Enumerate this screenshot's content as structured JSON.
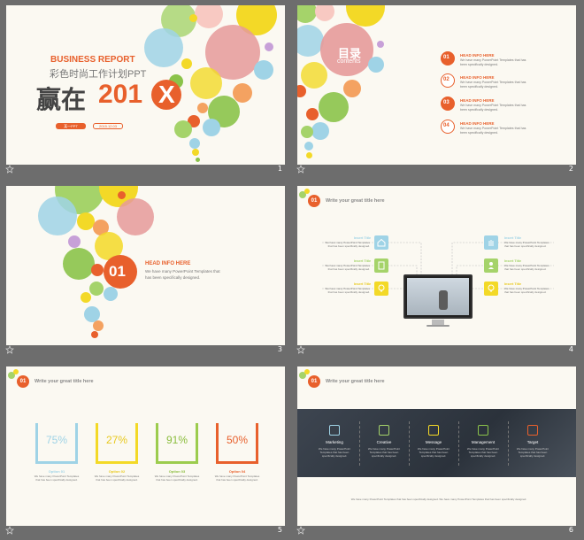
{
  "slides": [
    {
      "number": "1",
      "business_report": "BUSINESS REPORT",
      "subtitle_cn": "彩色时尚工作计划PPT",
      "title_cn": "赢在",
      "year": "201",
      "year_x": "X",
      "tag_left": "某一PPT",
      "tag_right": "2015.12.03"
    },
    {
      "number": "2",
      "toc_title": "目录",
      "toc_sub": "contents",
      "items": [
        {
          "num": "01",
          "head": "HEAD INFO HERE",
          "desc": "We have many PowerPoint Templates that has been specifically designed."
        },
        {
          "num": "02",
          "head": "HEAD INFO HERE",
          "desc": "We have many PowerPoint Templates that has been specifically designed."
        },
        {
          "num": "03",
          "head": "HEAD INFO HERE",
          "desc": "We have many PowerPoint Templates that has been specifically designed."
        },
        {
          "num": "04",
          "head": "HEAD INFO HERE",
          "desc": "We have many PowerPoint Templates that has been specifically designed."
        }
      ]
    },
    {
      "number": "3",
      "badge": "01",
      "head": "HEAD INFO HERE",
      "desc1": "We have many PowerPoint Templates that",
      "desc2": "has been specifically designed."
    },
    {
      "number": "4",
      "badge": "01",
      "title": "Write your great title here",
      "left": [
        {
          "label": "Insert Title",
          "desc": "We have many PowerPoint Templates that has been specifically designed."
        },
        {
          "label": "Insert Title",
          "desc": "We have many PowerPoint Templates that has been specifically designed."
        },
        {
          "label": "Insert Title",
          "desc": "We have many PowerPoint Templates that has been specifically designed."
        }
      ],
      "right": [
        {
          "label": "Insert Title",
          "desc": "We have many PowerPoint Templates that has been specifically designed."
        },
        {
          "label": "Insert Title",
          "desc": "We have many PowerPoint Templates that has been specifically designed."
        },
        {
          "label": "Insert Title",
          "desc": "We have many PowerPoint Templates that has been specifically designed."
        }
      ]
    },
    {
      "number": "5",
      "badge": "01",
      "title": "Write your great title here",
      "options": [
        {
          "percent": "75%",
          "fraction": 0.75,
          "name": "Option 01",
          "color": "#9fd3e6",
          "text": "#9fd3e6",
          "desc": "We have many PowerPoint Templates that has been specifically designed."
        },
        {
          "percent": "27%",
          "fraction": 0.27,
          "name": "Option 02",
          "color": "#f3d927",
          "text": "#e8c91f",
          "desc": "We have many PowerPoint Templates that has been specifically designed."
        },
        {
          "percent": "91%",
          "fraction": 0.91,
          "name": "Option 03",
          "color": "#9ccc4e",
          "text": "#8bbd3e",
          "desc": "We have many PowerPoint Templates that has been specifically designed."
        },
        {
          "percent": "50%",
          "fraction": 0.5,
          "name": "Option 04",
          "color": "#e8602c",
          "text": "#e8602c",
          "desc": "We have many PowerPoint Templates that has been specifically designed."
        }
      ]
    },
    {
      "number": "6",
      "badge": "01",
      "title": "Write your great title here",
      "cols": [
        {
          "name": "Marketing",
          "icon": "rocket-icon",
          "desc": "We have many PowerPoint Templates that has been specifically designed."
        },
        {
          "name": "Creative",
          "icon": "camera-icon",
          "desc": "We have many PowerPoint Templates that has been specifically designed."
        },
        {
          "name": "Message",
          "icon": "message-icon",
          "desc": "We have many PowerPoint Templates that has been specifically designed."
        },
        {
          "name": "Management",
          "icon": "gauge-icon",
          "desc": "We have many PowerPoint Templates that has been specifically designed."
        },
        {
          "name": "Target",
          "icon": "document-icon",
          "desc": "We have many PowerPoint Templates that has been specifically designed."
        }
      ],
      "bottom_text": "We have many PowerPoint Templates that has been specifically designed. We have many PowerPoint Templates that has been specifically designed."
    }
  ],
  "colors": {
    "accent": "#e8602c",
    "background": "#6d6d6d",
    "slide_bg": "#fbf9f2"
  }
}
